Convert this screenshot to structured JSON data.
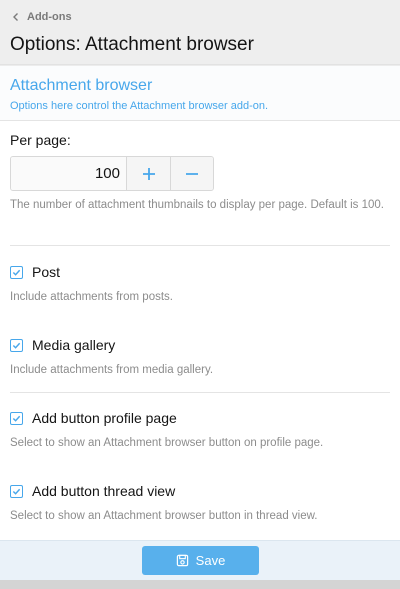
{
  "header": {
    "breadcrumb": "Add-ons",
    "title": "Options: Attachment browser"
  },
  "section": {
    "title": "Attachment browser",
    "description": "Options here control the Attachment browser add-on."
  },
  "per_page": {
    "label": "Per page:",
    "value": "100",
    "hint": "The number of attachment thumbnails to display per page. Default is 100."
  },
  "options": [
    {
      "label": "Post",
      "checked": true,
      "hint": "Include attachments from posts."
    },
    {
      "label": "Media gallery",
      "checked": true,
      "hint": "Include attachments from media gallery."
    },
    {
      "label": "Add button profile page",
      "checked": true,
      "hint": "Select to show an Attachment browser button on profile page."
    },
    {
      "label": "Add button thread view",
      "checked": true,
      "hint": "Select to show an Attachment browser button in thread view."
    }
  ],
  "footer": {
    "save_label": "Save"
  },
  "colors": {
    "accent": "#47a7eb",
    "button": "#58b0ec"
  },
  "icons": [
    "chevron-left-icon",
    "plus-icon",
    "minus-icon",
    "checkmark-icon",
    "save-icon"
  ]
}
